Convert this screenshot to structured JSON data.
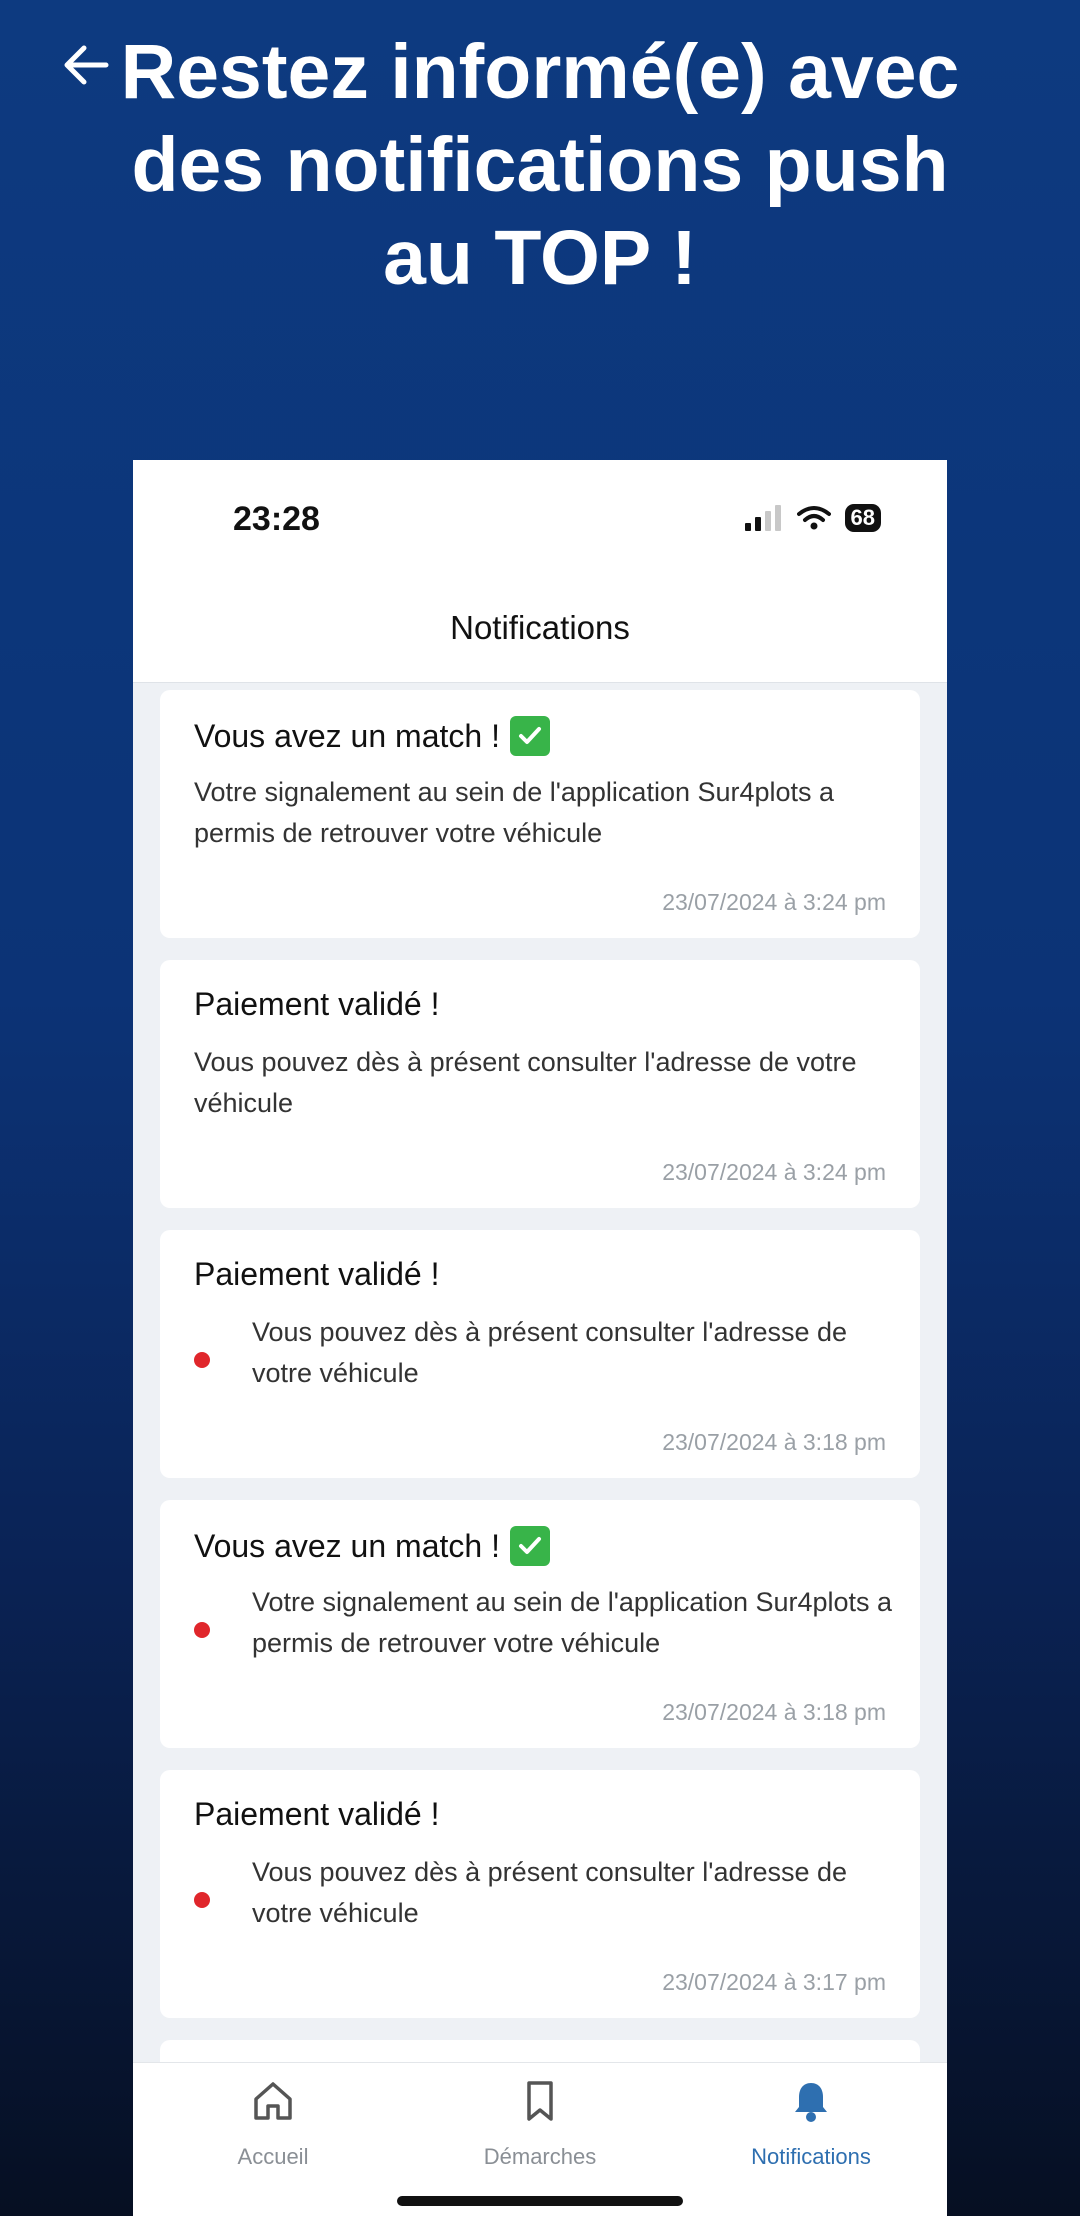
{
  "headline": {
    "lines": [
      "Restez informé(e) avec",
      "des notifications push",
      "au TOP !"
    ]
  },
  "back_icon": "arrow-left-icon",
  "status_bar": {
    "time": "23:28",
    "battery": "68"
  },
  "header": {
    "title": "Notifications"
  },
  "notifications": [
    {
      "title": "Vous avez un match !",
      "emoji": "check-icon",
      "body": "Votre signalement au sein de l'application Sur4plots a permis de retrouver votre véhicule",
      "date": "23/07/2024 à 3:24 pm",
      "unread": false
    },
    {
      "title": "Paiement validé !",
      "body": "Vous pouvez dès à présent consulter l'adresse de votre véhicule",
      "date": "23/07/2024 à 3:24 pm",
      "unread": false
    },
    {
      "title": "Paiement validé !",
      "body": "Vous pouvez dès à présent consulter l'adresse de votre véhicule",
      "date": "23/07/2024 à 3:18 pm",
      "unread": true
    },
    {
      "title": "Vous avez un match !",
      "emoji": "check-icon",
      "body": "Votre signalement au sein de l'application Sur4plots a permis de retrouver votre véhicule",
      "date": "23/07/2024 à 3:18 pm",
      "unread": true
    },
    {
      "title": "Paiement validé !",
      "body": "Vous pouvez dès à présent consulter l'adresse de votre véhicule",
      "date": "23/07/2024 à 3:17 pm",
      "unread": true
    }
  ],
  "tabs": [
    {
      "label": "Accueil",
      "icon": "home-icon",
      "active": false
    },
    {
      "label": "Démarches",
      "icon": "bookmark-icon",
      "active": false
    },
    {
      "label": "Notifications",
      "icon": "bell-icon",
      "active": true
    }
  ],
  "colors": {
    "accent": "#2e6fb0",
    "unread_dot": "#e0262b",
    "check": "#38b449",
    "background": "#0c3376"
  }
}
